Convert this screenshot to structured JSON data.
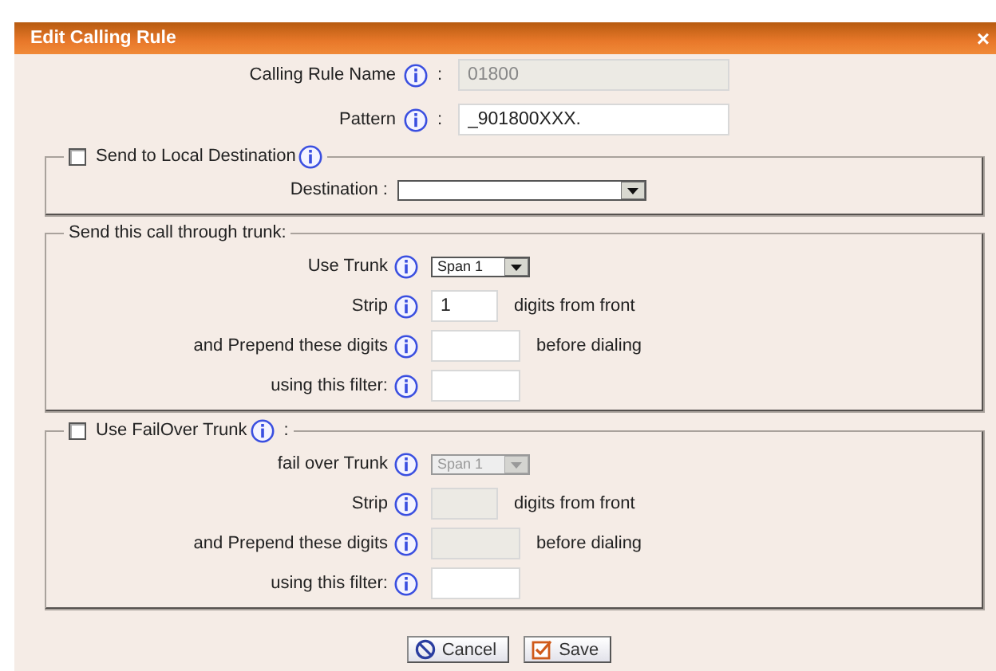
{
  "dialog": {
    "title": "Edit Calling Rule",
    "close": "×"
  },
  "top_fields": [
    {
      "label": "Calling Rule Name",
      "info": true,
      "colon": ":",
      "value": "01800",
      "disabled": true
    },
    {
      "label": "Pattern",
      "info": true,
      "colon": ":",
      "value": "_901800XXX.",
      "disabled": false
    }
  ],
  "sections": [
    {
      "kind": "checkbox",
      "legend": "Send to Local Destination",
      "legend_info": true,
      "checked": false,
      "rows": [
        {
          "kind": "wide_select",
          "label": "Destination :",
          "info": false,
          "value": "",
          "disabled": false
        }
      ]
    },
    {
      "kind": "plain",
      "legend": "Send this call through trunk:",
      "legend_info": false,
      "rows": [
        {
          "kind": "select",
          "label": "Use Trunk",
          "info": true,
          "value": "Span 1",
          "disabled": false
        },
        {
          "kind": "short_text",
          "label": "Strip",
          "info": true,
          "value": "1",
          "disabled": false,
          "suffix": "digits from front"
        },
        {
          "kind": "text",
          "label": "and Prepend these digits",
          "info": true,
          "value": "",
          "disabled": false,
          "suffix": "before dialing"
        },
        {
          "kind": "text",
          "label": "using this filter:",
          "info": true,
          "value": "",
          "disabled": false
        }
      ]
    },
    {
      "kind": "checkbox",
      "legend": "Use FailOver Trunk",
      "legend_info": true,
      "legend_colon": ":",
      "checked": false,
      "rows": [
        {
          "kind": "select",
          "label": "fail over Trunk",
          "info": true,
          "value": "Span 1",
          "disabled": true
        },
        {
          "kind": "short_text",
          "label": "Strip",
          "info": true,
          "value": "",
          "disabled": true,
          "suffix": "digits from front"
        },
        {
          "kind": "text",
          "label": "and Prepend these digits",
          "info": true,
          "value": "",
          "disabled": true,
          "suffix": "before dialing"
        },
        {
          "kind": "text",
          "label": "using this filter:",
          "info": true,
          "value": "",
          "disabled": false
        }
      ]
    }
  ],
  "buttons": [
    {
      "kind": "cancel",
      "label": "Cancel"
    },
    {
      "kind": "save",
      "label": "Save"
    }
  ]
}
